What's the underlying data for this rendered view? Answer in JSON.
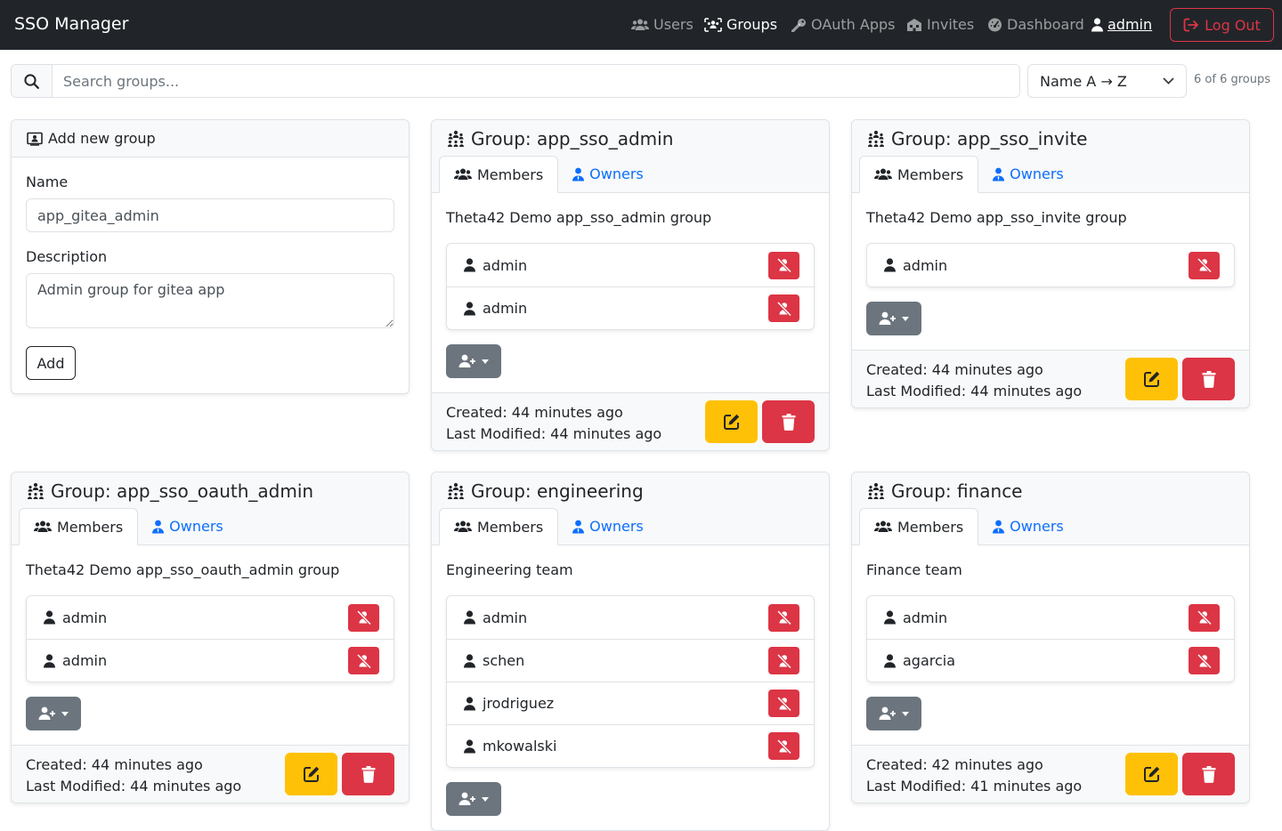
{
  "app": {
    "title": "SSO Manager"
  },
  "nav": {
    "users": "Users",
    "groups": "Groups",
    "oauth_apps": "OAuth Apps",
    "invites": "Invites",
    "dashboard": "Dashboard",
    "user": "admin",
    "logout": "Log Out"
  },
  "search": {
    "placeholder": "Search groups...",
    "value": ""
  },
  "sort": {
    "selected": "Name A → Z"
  },
  "group_count": "6 of 6 groups",
  "add_form": {
    "title": "Add new group",
    "name_label": "Name",
    "name_value": "app_gitea_admin",
    "description_label": "Description",
    "description_value": "Admin group for gitea app",
    "add_label": "Add"
  },
  "groups": [
    {
      "title": "Group: app_sso_admin",
      "tab_members": "Members",
      "tab_owners": "Owners",
      "description": "Theta42 Demo app_sso_admin group",
      "members": [
        "admin",
        "admin"
      ],
      "created": "Created: 44 minutes ago",
      "modified": "Last Modified: 44 minutes ago"
    },
    {
      "title": "Group: app_sso_invite",
      "tab_members": "Members",
      "tab_owners": "Owners",
      "description": "Theta42 Demo app_sso_invite group",
      "members": [
        "admin"
      ],
      "created": "Created: 44 minutes ago",
      "modified": "Last Modified: 44 minutes ago"
    },
    {
      "title": "Group: app_sso_oauth_admin",
      "tab_members": "Members",
      "tab_owners": "Owners",
      "description": "Theta42 Demo app_sso_oauth_admin group",
      "members": [
        "admin",
        "admin"
      ],
      "created": "Created: 44 minutes ago",
      "modified": "Last Modified: 44 minutes ago"
    },
    {
      "title": "Group: engineering",
      "tab_members": "Members",
      "tab_owners": "Owners",
      "description": "Engineering team",
      "members": [
        "admin",
        "schen",
        "jrodriguez",
        "mkowalski"
      ],
      "created": "",
      "modified": ""
    },
    {
      "title": "Group: finance",
      "tab_members": "Members",
      "tab_owners": "Owners",
      "description": "Finance team",
      "members": [
        "admin",
        "agarcia"
      ],
      "created": "Created: 42 minutes ago",
      "modified": "Last Modified: 41 minutes ago"
    }
  ],
  "colors": {
    "navbar_bg": "#212529",
    "primary": "#0d6efd",
    "danger": "#dc3545",
    "warning": "#ffc107",
    "secondary": "#6c757d"
  }
}
